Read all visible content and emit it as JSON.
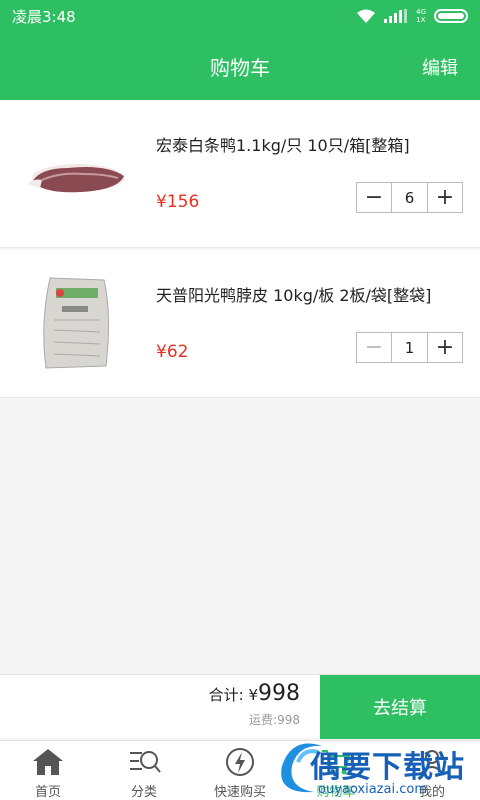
{
  "status_bar": {
    "time": "凌晨3:48",
    "network_top": "4G",
    "network_bottom": "1X"
  },
  "header": {
    "title": "购物车",
    "edit_label": "编辑"
  },
  "cart": {
    "items": [
      {
        "name": "宏泰白条鸭1.1kg/只 10只/箱[整箱]",
        "price": "¥156",
        "quantity": "6",
        "image": "duck-photo"
      },
      {
        "name": "天普阳光鸭脖皮 10kg/板 2板/袋[整袋]",
        "price": "¥62",
        "quantity": "1",
        "image": "sack-photo"
      }
    ]
  },
  "footer": {
    "total_label": "合计: ¥",
    "total_amount": "998",
    "shipping": "运费:998",
    "checkout_label": "去结算"
  },
  "tabs": [
    {
      "label": "首页",
      "icon": "home-icon"
    },
    {
      "label": "分类",
      "icon": "category-search-icon"
    },
    {
      "label": "快速购买",
      "icon": "lightning-icon"
    },
    {
      "label": "购物车",
      "icon": "cart-icon"
    },
    {
      "label": "我的",
      "icon": "user-icon"
    }
  ],
  "watermark": {
    "text": "偶要下载站",
    "url": "ouyaoxiazai.com"
  },
  "colors": {
    "brand": "#2fbf63",
    "price": "#e8301e",
    "watermark": "#1660b8"
  }
}
